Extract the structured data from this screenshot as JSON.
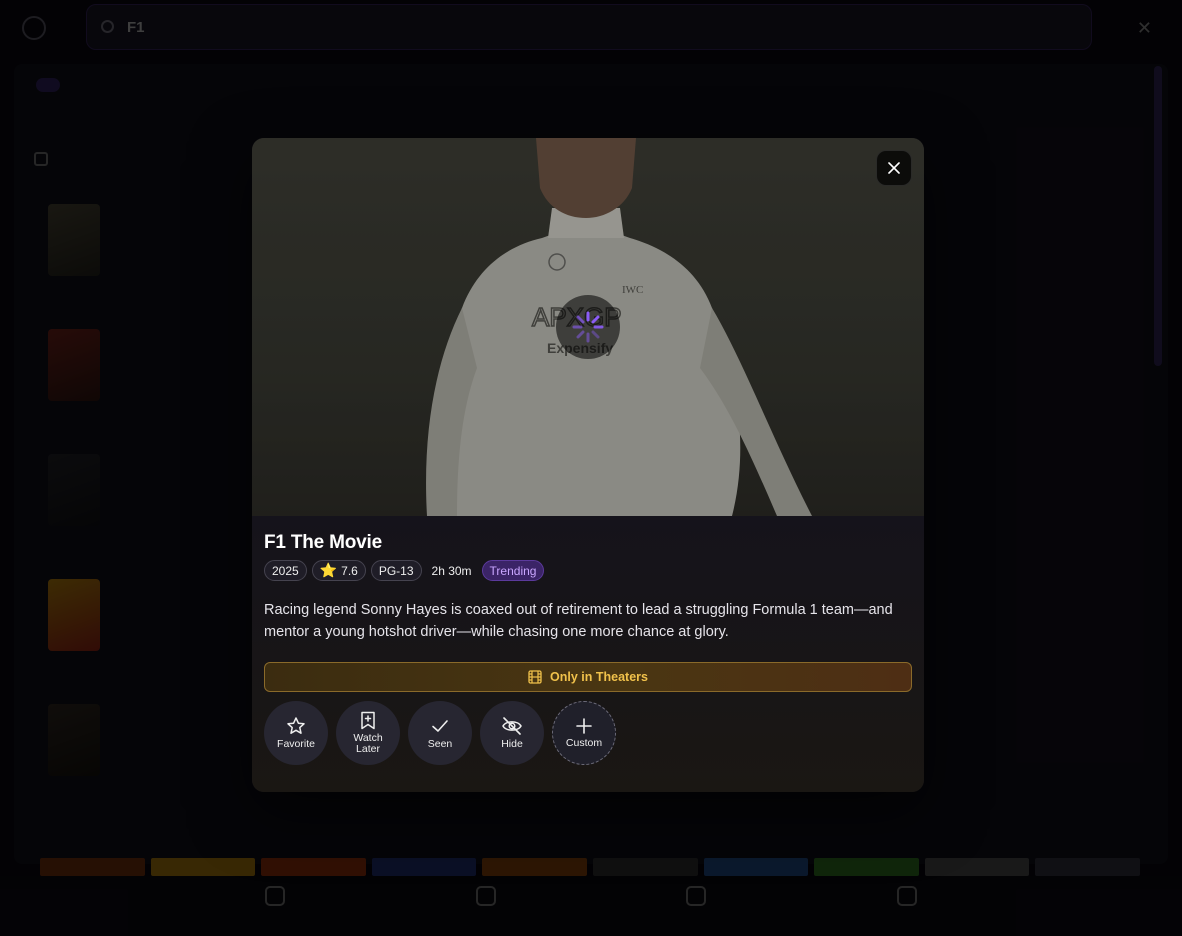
{
  "search": {
    "query": "F1"
  },
  "tabs": [
    {
      "label": ""
    },
    {
      "label": ""
    },
    {
      "label": ""
    }
  ],
  "modal": {
    "title": "F1 The Movie",
    "meta": {
      "year": "2025",
      "rating": "7.6",
      "certification": "PG-13",
      "runtime": "2h 30m",
      "badge": "Trending"
    },
    "description": "Racing legend Sonny Hayes is coaxed out of retirement to lead a struggling Formula 1 team—and mentor a young hotshot driver—while chasing one more chance at glory.",
    "availability": "Only in Theaters",
    "actions": [
      {
        "label": "Favorite",
        "icon": "star-icon"
      },
      {
        "label": "Watch Later",
        "icon": "bookmark-icon"
      },
      {
        "label": "Seen",
        "icon": "check-icon"
      },
      {
        "label": "Hide",
        "icon": "eye-off-icon"
      },
      {
        "label": "Custom",
        "icon": "plus-icon"
      }
    ]
  },
  "colors": {
    "accent": "#7c4dff",
    "trending_bg": "#3b2467",
    "theater_text": "#f0c14b",
    "star": "#f5c518"
  }
}
